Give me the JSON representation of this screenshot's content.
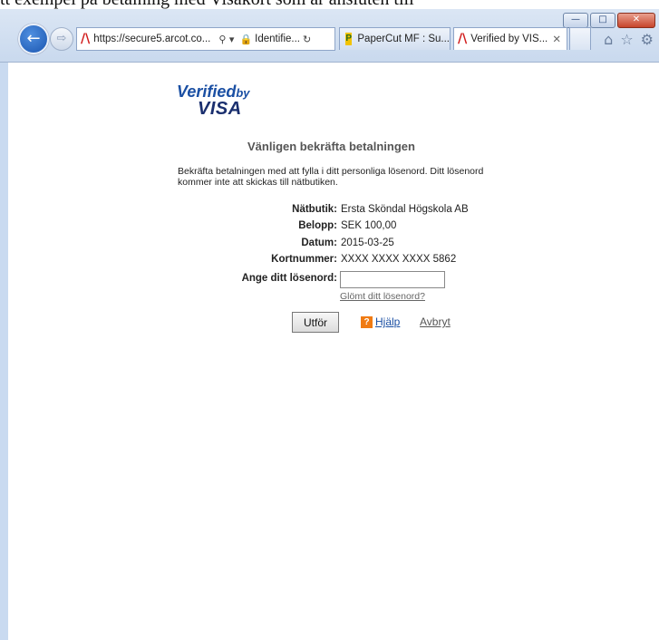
{
  "caption": "tt exempel på betalning med Visakort som är ansluten till",
  "browser": {
    "window_buttons": {
      "minimize": "—",
      "maximize": "□",
      "close": "✕"
    },
    "back_icon": "←",
    "forward_icon": "⇨",
    "address": {
      "url": "https://secure5.arcot.co...",
      "search_icon": "⚲ ▾",
      "lock_icon": "🔒",
      "identity": "Identifie...",
      "refresh_icon": "↻"
    },
    "tabs": [
      {
        "label": "PaperCut MF : Su...",
        "icon": "P"
      },
      {
        "label": "Verified by VIS...",
        "close": "✕"
      }
    ],
    "toolbar_icons": {
      "home": "⌂",
      "favorites": "☆",
      "settings": "⚙"
    }
  },
  "page": {
    "logo": {
      "line1": "Verified",
      "by": "by",
      "line2": "VISA"
    },
    "title": "Vänligen bekräfta betalningen",
    "instruction": "Bekräfta betalningen med att fylla i ditt personliga lösenord. Ditt lösenord kommer inte att skickas till nätbutiken.",
    "fields": [
      {
        "label": "Nätbutik:",
        "value": "Ersta Sköndal Högskola AB"
      },
      {
        "label": "Belopp:",
        "value": "SEK 100,00"
      },
      {
        "label": "Datum:",
        "value": "2015-03-25"
      },
      {
        "label": "Kortnummer:",
        "value": "XXXX XXXX XXXX 5862"
      }
    ],
    "password_label": "Ange ditt lösenord:",
    "password_value": "",
    "forgot_link": "Glömt ditt lösenord?",
    "submit_label": "Utför",
    "help_icon": "?",
    "help_label": "Hjälp",
    "cancel_label": "Avbryt"
  },
  "colors": {
    "arcot_red": "#d11c1c",
    "visa_blue": "#1a4fa3",
    "help_orange": "#f07b13"
  }
}
